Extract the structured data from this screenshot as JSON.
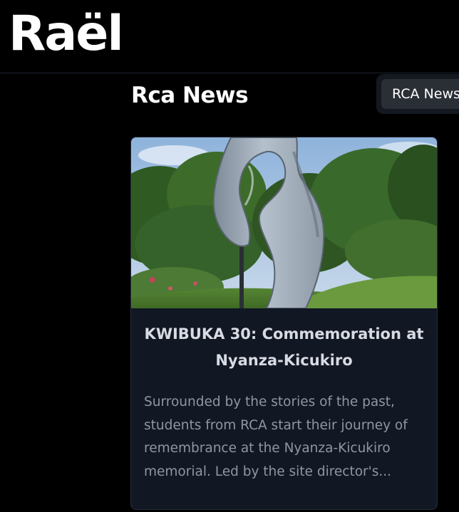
{
  "header": {
    "logo_text": "Raël"
  },
  "main": {
    "title": "Rca News",
    "tabs": [
      {
        "label": "RCA News"
      }
    ]
  },
  "articles": [
    {
      "image_subject": "memorial-sculpture-photo",
      "title": "KWIBUKA 30: Commemoration at Nyanza-Kicukiro",
      "excerpt": "Surrounded by the stories of the past, students from RCA start their journey of remembrance at the Nyanza-Kicukiro memorial. Led by the site director's..."
    }
  ],
  "colors": {
    "background": "#000000",
    "card_background": "#121724",
    "card_border": "#262d3b",
    "title_text": "#d8dbe2",
    "excerpt_text": "#8f96a3",
    "tab_button": "#2a2e35"
  }
}
